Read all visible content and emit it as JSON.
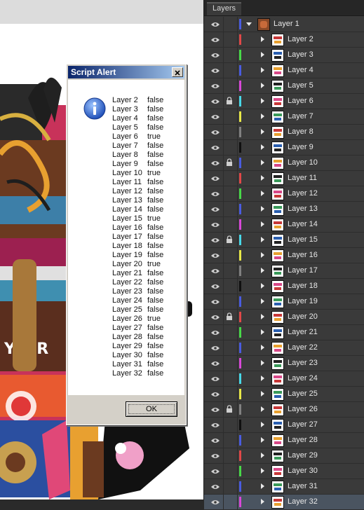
{
  "panel": {
    "tab_label": "Layers",
    "parent": {
      "name": "Layer 1",
      "color": "#4a5ce0"
    },
    "layers": [
      {
        "name": "Layer 2",
        "color": "#e04848",
        "locked": false
      },
      {
        "name": "Layer 3",
        "color": "#48d848",
        "locked": false
      },
      {
        "name": "Layer 4",
        "color": "#4a5ce0",
        "locked": false
      },
      {
        "name": "Layer 5",
        "color": "#d848d8",
        "locked": false
      },
      {
        "name": "Layer 6",
        "color": "#48d8e8",
        "locked": true
      },
      {
        "name": "Layer 7",
        "color": "#e8e848",
        "locked": false
      },
      {
        "name": "Layer 8",
        "color": "#808080",
        "locked": false
      },
      {
        "name": "Layer 9",
        "color": "#101010",
        "locked": false
      },
      {
        "name": "Layer 10",
        "color": "#4a5ce0",
        "locked": true
      },
      {
        "name": "Layer 11",
        "color": "#e04848",
        "locked": false
      },
      {
        "name": "Layer 12",
        "color": "#48d848",
        "locked": false
      },
      {
        "name": "Layer 13",
        "color": "#4a5ce0",
        "locked": false
      },
      {
        "name": "Layer 14",
        "color": "#d848d8",
        "locked": false
      },
      {
        "name": "Layer 15",
        "color": "#48d8e8",
        "locked": true
      },
      {
        "name": "Layer 16",
        "color": "#e8e848",
        "locked": false
      },
      {
        "name": "Layer 17",
        "color": "#808080",
        "locked": false
      },
      {
        "name": "Layer 18",
        "color": "#101010",
        "locked": false
      },
      {
        "name": "Layer 19",
        "color": "#4a5ce0",
        "locked": false
      },
      {
        "name": "Layer 20",
        "color": "#e04848",
        "locked": true
      },
      {
        "name": "Layer 21",
        "color": "#48d848",
        "locked": false
      },
      {
        "name": "Layer 22",
        "color": "#4a5ce0",
        "locked": false
      },
      {
        "name": "Layer 23",
        "color": "#d848d8",
        "locked": false
      },
      {
        "name": "Layer 24",
        "color": "#48d8e8",
        "locked": false
      },
      {
        "name": "Layer 25",
        "color": "#e8e848",
        "locked": false
      },
      {
        "name": "Layer 26",
        "color": "#808080",
        "locked": true
      },
      {
        "name": "Layer 27",
        "color": "#101010",
        "locked": false
      },
      {
        "name": "Layer 28",
        "color": "#4a5ce0",
        "locked": false
      },
      {
        "name": "Layer 29",
        "color": "#e04848",
        "locked": false
      },
      {
        "name": "Layer 30",
        "color": "#48d848",
        "locked": false
      },
      {
        "name": "Layer 31",
        "color": "#4a5ce0",
        "locked": false
      },
      {
        "name": "Layer 32",
        "color": "#d848d8",
        "locked": false,
        "selected": true
      }
    ]
  },
  "dialog": {
    "title": "Script Alert",
    "ok_label": "OK",
    "lines": [
      {
        "layer": "Layer 2",
        "value": "false"
      },
      {
        "layer": "Layer 3",
        "value": "false"
      },
      {
        "layer": "Layer 4",
        "value": "false"
      },
      {
        "layer": "Layer 5",
        "value": "false"
      },
      {
        "layer": "Layer 6",
        "value": "true"
      },
      {
        "layer": "Layer 7",
        "value": "false"
      },
      {
        "layer": "Layer 8",
        "value": "false"
      },
      {
        "layer": "Layer 9",
        "value": "false"
      },
      {
        "layer": "Layer 10",
        "value": "true"
      },
      {
        "layer": "Layer 11",
        "value": "false"
      },
      {
        "layer": "Layer 12",
        "value": "false"
      },
      {
        "layer": "Layer 13",
        "value": "false"
      },
      {
        "layer": "Layer 14",
        "value": "false"
      },
      {
        "layer": "Layer 15",
        "value": "true"
      },
      {
        "layer": "Layer 16",
        "value": "false"
      },
      {
        "layer": "Layer 17",
        "value": "false"
      },
      {
        "layer": "Layer 18",
        "value": "false"
      },
      {
        "layer": "Layer 19",
        "value": "false"
      },
      {
        "layer": "Layer 20",
        "value": "true"
      },
      {
        "layer": "Layer 21",
        "value": "false"
      },
      {
        "layer": "Layer 22",
        "value": "false"
      },
      {
        "layer": "Layer 23",
        "value": "false"
      },
      {
        "layer": "Layer 24",
        "value": "false"
      },
      {
        "layer": "Layer 25",
        "value": "false"
      },
      {
        "layer": "Layer 26",
        "value": "true"
      },
      {
        "layer": "Layer 27",
        "value": "false"
      },
      {
        "layer": "Layer 28",
        "value": "false"
      },
      {
        "layer": "Layer 29",
        "value": "false"
      },
      {
        "layer": "Layer 30",
        "value": "false"
      },
      {
        "layer": "Layer 31",
        "value": "false"
      },
      {
        "layer": "Layer 32",
        "value": "false"
      }
    ]
  },
  "icons": {
    "visibility": "eye-icon",
    "lock": "lock-icon",
    "expand": "triangle-right-icon",
    "collapse": "triangle-down-icon",
    "dialog": "info-icon",
    "close": "close-icon"
  }
}
